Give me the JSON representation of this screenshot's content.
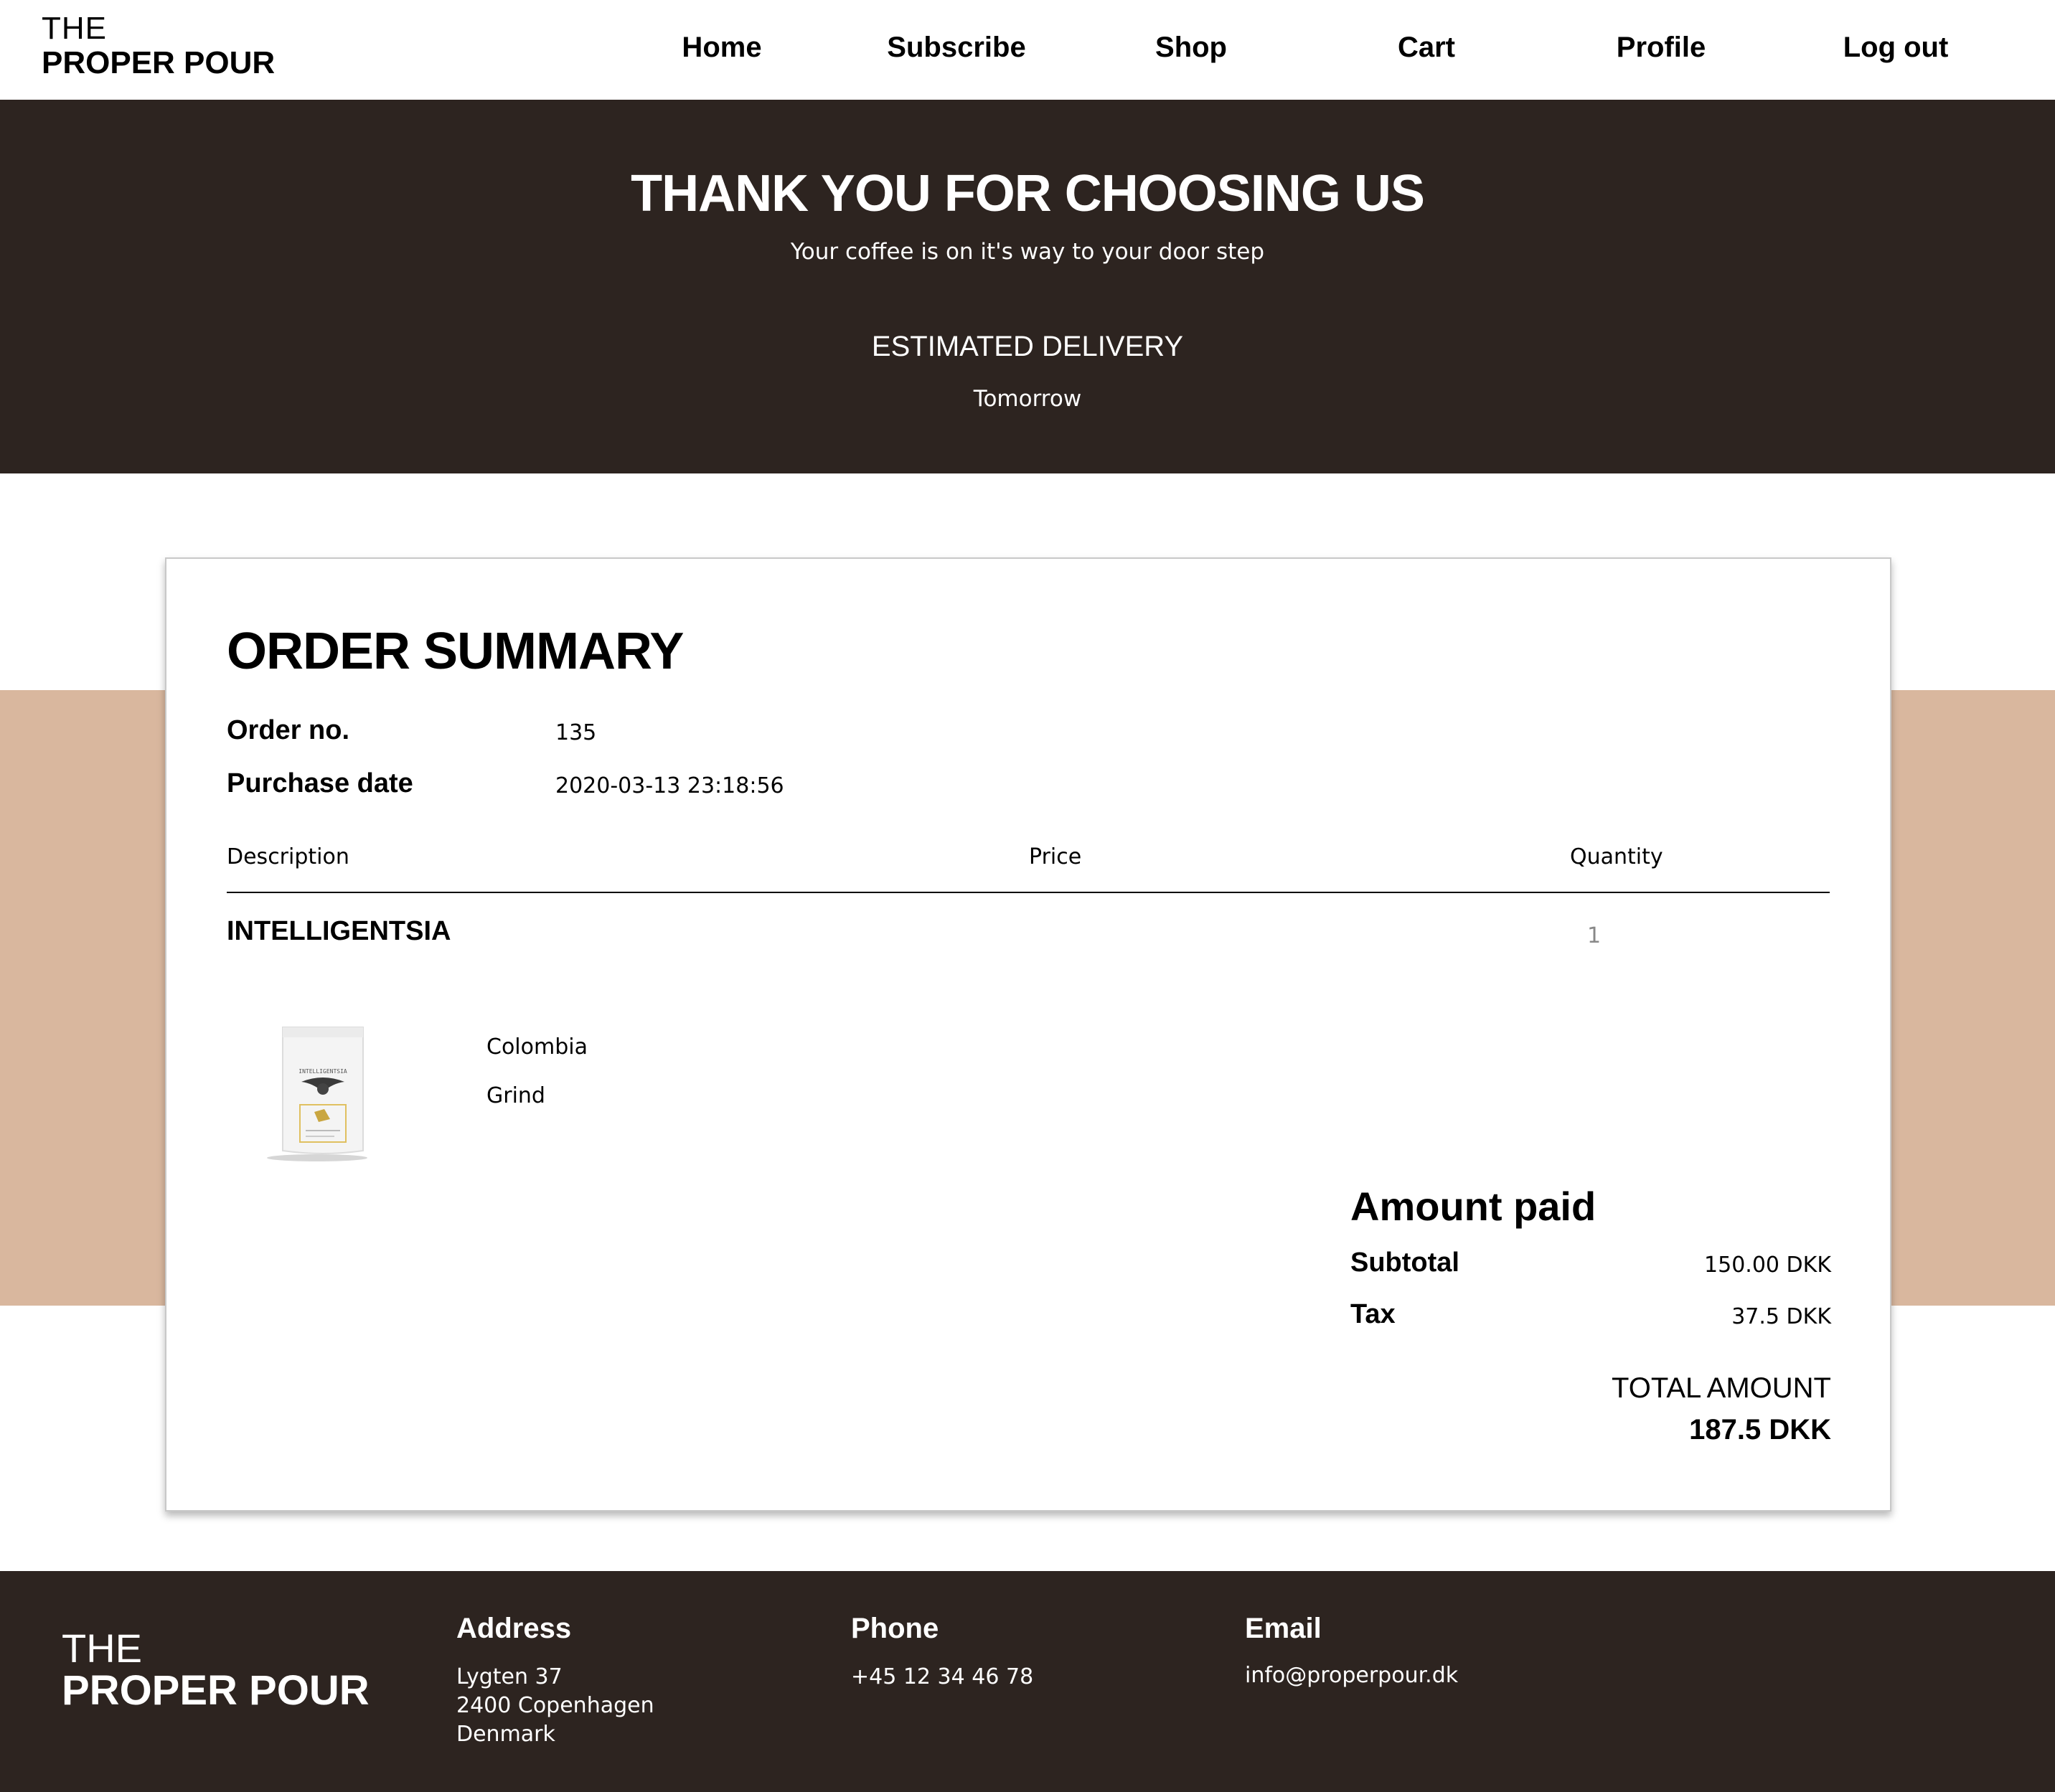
{
  "brand": {
    "line1": "THE",
    "line2": "PROPER POUR"
  },
  "nav": {
    "home": "Home",
    "subscribe": "Subscribe",
    "shop": "Shop",
    "cart": "Cart",
    "profile": "Profile",
    "logout": "Log out"
  },
  "hero": {
    "title": "THANK YOU FOR CHOOSING US",
    "subtitle": "Your coffee is on it's way to your door step",
    "estimated_label": "ESTIMATED DELIVERY",
    "estimated_value": "Tomorrow"
  },
  "summary": {
    "title": "ORDER SUMMARY",
    "order_no_label": "Order no.",
    "order_no": "135",
    "purchase_date_label": "Purchase date",
    "purchase_date": "2020-03-13 23:18:56",
    "columns": {
      "description": "Description",
      "price": "Price",
      "quantity": "Quantity"
    },
    "item": {
      "name": "INTELLIGENTSIA",
      "quantity": "1",
      "origin": "Colombia",
      "grind": "Grind",
      "image_icon": "coffee-bag-image"
    },
    "amount": {
      "title": "Amount paid",
      "subtotal_label": "Subtotal",
      "subtotal": "150.00 DKK",
      "tax_label": "Tax",
      "tax": "37.5 DKK",
      "total_label": "TOTAL AMOUNT",
      "total": "187.5 DKK"
    }
  },
  "footer": {
    "address_label": "Address",
    "address_line1": "Lygten 37",
    "address_line2": "2400 Copenhagen",
    "address_line3": "Denmark",
    "phone_label": "Phone",
    "phone": "+45 12 34 46 78",
    "email_label": "Email",
    "email": "info@properpour.dk"
  },
  "colors": {
    "dark": "#2d2420",
    "tan": "#d9b79e",
    "white": "#ffffff"
  }
}
